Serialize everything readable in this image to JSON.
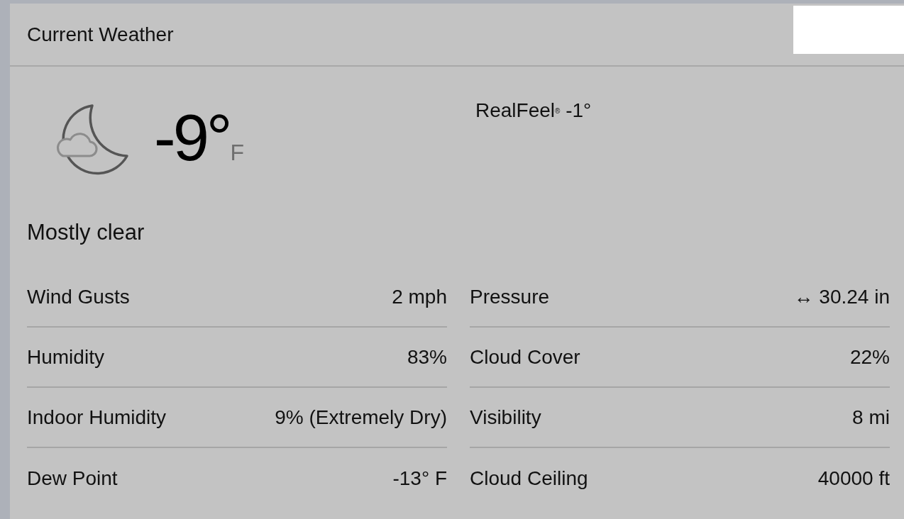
{
  "header": {
    "title": "Current Weather"
  },
  "current": {
    "temperature": "-9°",
    "unit": "F",
    "realfeel": "RealFeel$^{®}$ -1°",
    "condition": "Mostly clear"
  },
  "details": {
    "left": [
      {
        "label": "Wind Gusts",
        "value": "2 mph"
      },
      {
        "label": "Humidity",
        "value": "83%"
      },
      {
        "label": "Indoor Humidity",
        "value": "9% (Extremely Dry)"
      },
      {
        "label": "Dew Point",
        "value": "-13° F"
      }
    ],
    "right": [
      {
        "label": "Pressure",
        "value": "↔ 30.24 in"
      },
      {
        "label": "Cloud Cover",
        "value": "22%"
      },
      {
        "label": "Visibility",
        "value": "8 mi"
      },
      {
        "label": "Cloud Ceiling",
        "value": "40000 ft"
      }
    ]
  }
}
